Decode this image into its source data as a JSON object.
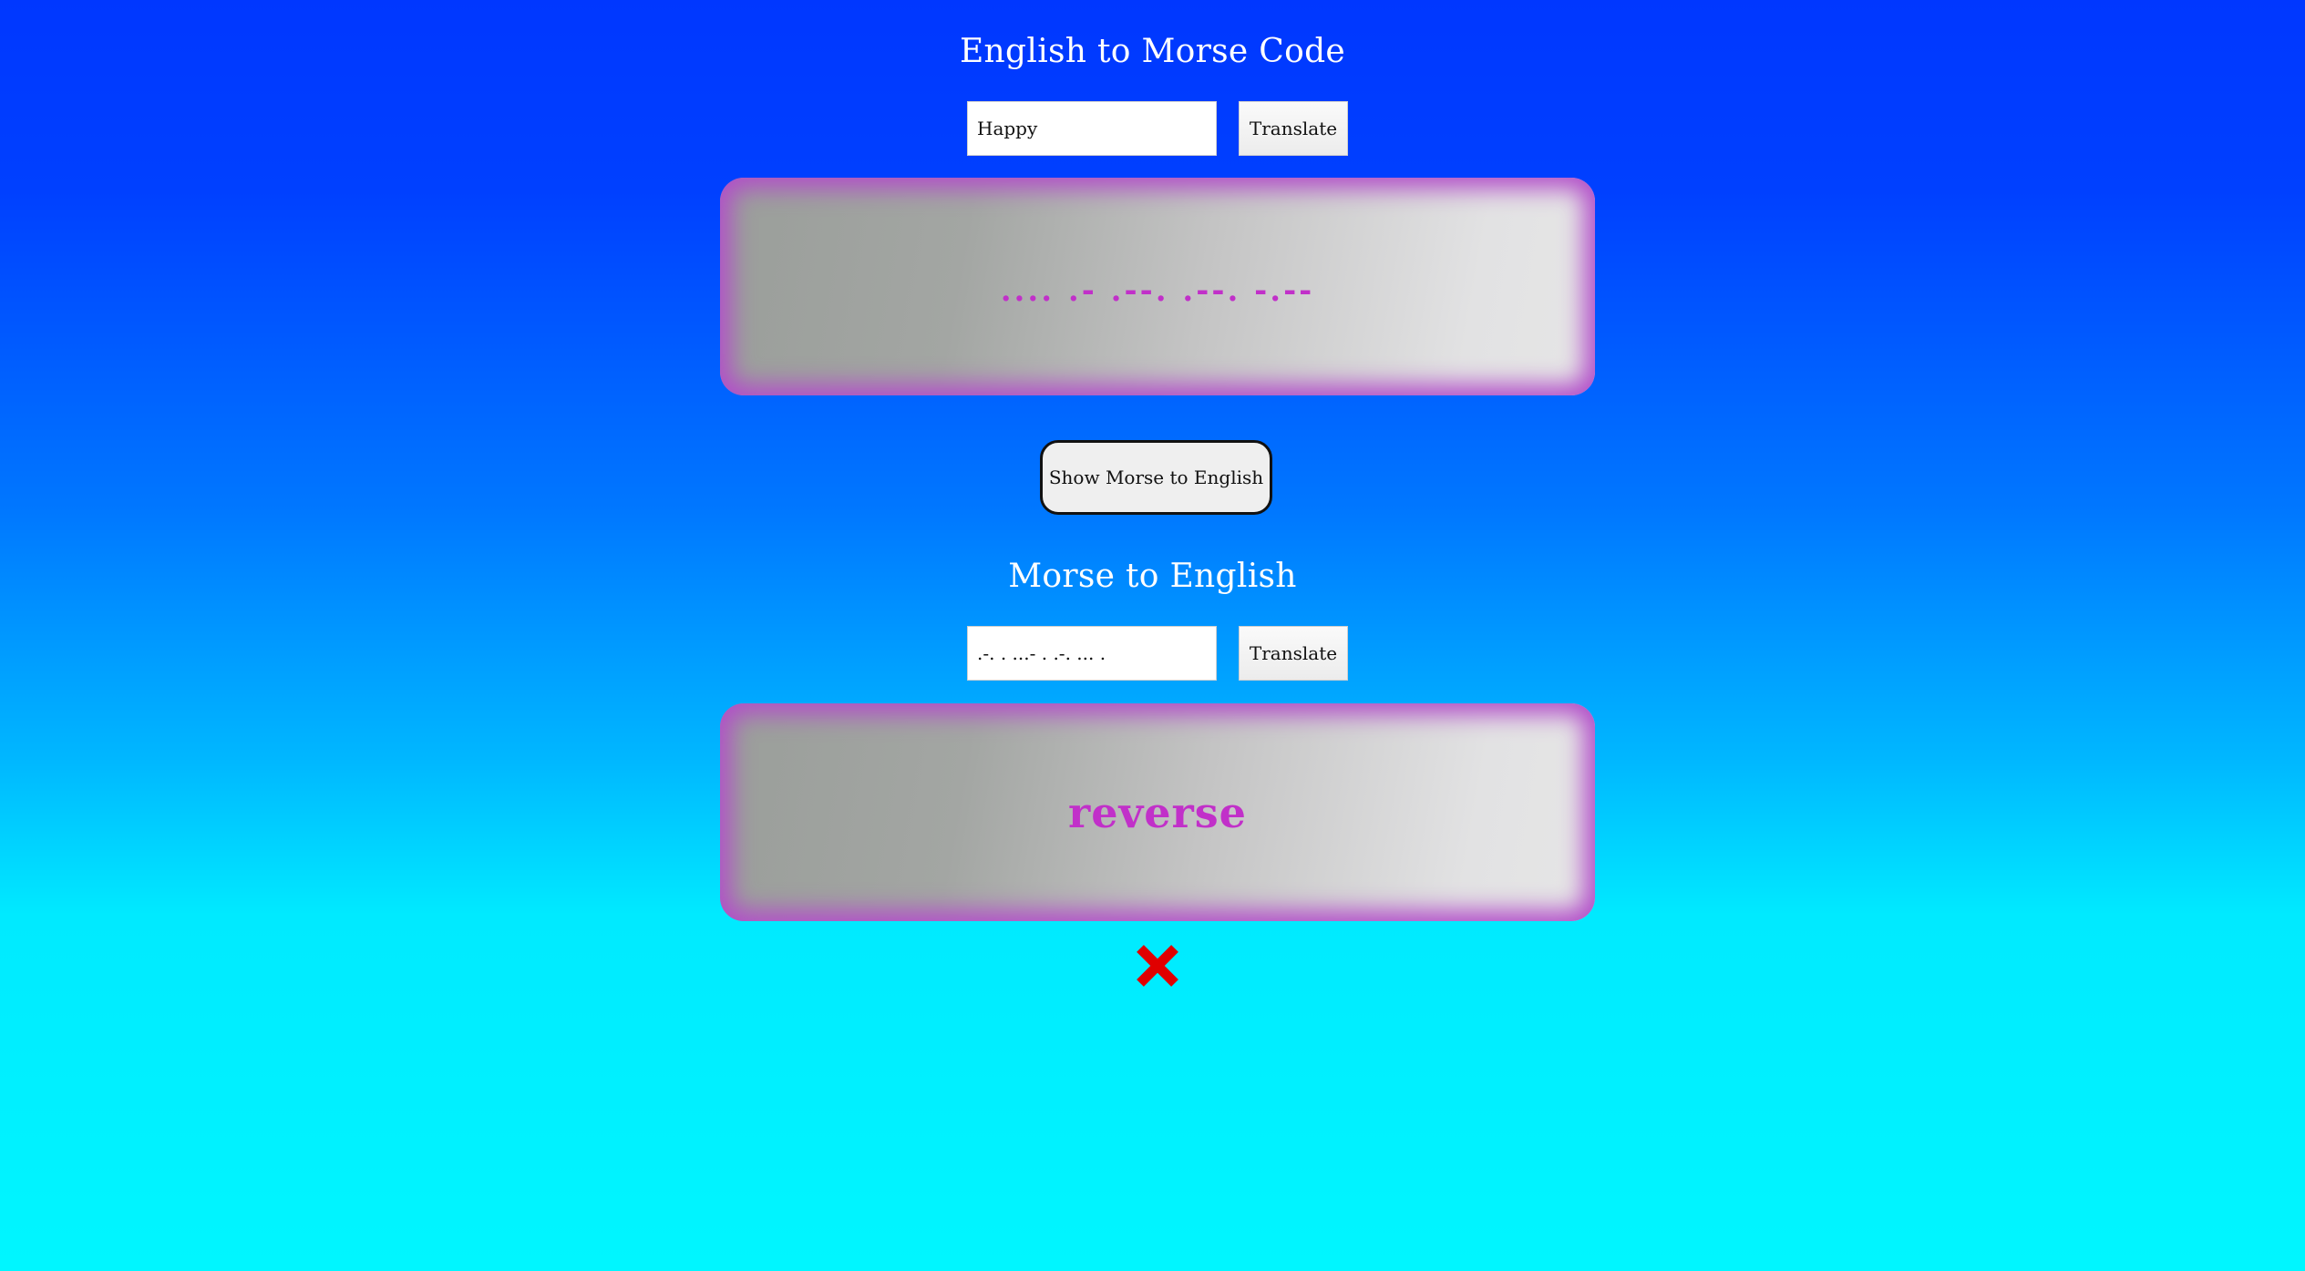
{
  "english_to_morse": {
    "title": "English to Morse Code",
    "input_value": "Happy",
    "translate_label": "Translate",
    "output": ".... .- .--. .--. -.--"
  },
  "toggle": {
    "label": "Show Morse to English"
  },
  "morse_to_english": {
    "title": "Morse to English",
    "input_value": ".-. . ...- . .-. ... .",
    "translate_label": "Translate",
    "output": "reverse"
  },
  "close": {
    "icon": "close-icon",
    "color": "#e00000"
  },
  "colors": {
    "output_text": "#c130c9",
    "output_glow": "#b24fc9",
    "title_text": "#ffffff"
  }
}
